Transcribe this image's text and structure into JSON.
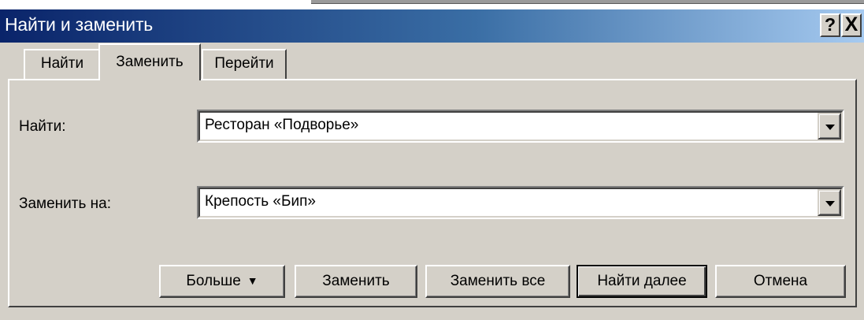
{
  "window": {
    "title": "Найти и заменить",
    "help_label": "?",
    "close_label": "X"
  },
  "tabs": [
    {
      "label": "Найти"
    },
    {
      "label": "Заменить"
    },
    {
      "label": "Перейти"
    }
  ],
  "fields": {
    "find_label": "Найти:",
    "find_value": "Ресторан «Подворье»",
    "replace_label": "Заменить на:",
    "replace_value": "Крепость «Бип»"
  },
  "buttons": {
    "more": "Больше",
    "replace": "Заменить",
    "replace_all": "Заменить все",
    "find_next": "Найти далее",
    "cancel": "Отмена"
  },
  "icons": {
    "more_icon": "double-chevron-down-icon",
    "dropdown_icon": "chevron-down-icon"
  },
  "colors": {
    "title_bar_start": "#0a246a",
    "title_bar_end": "#a6caf0",
    "dialog_face": "#d4d0c8"
  }
}
